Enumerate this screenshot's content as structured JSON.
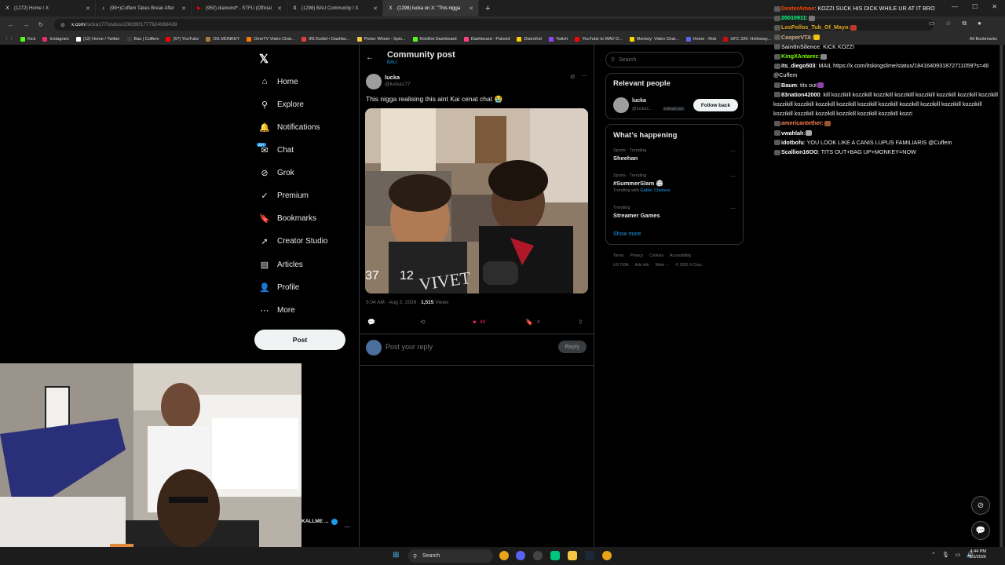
{
  "browser": {
    "tabs": [
      {
        "label": "(1272) Home / X",
        "fav": "X",
        "color": "#000000"
      },
      {
        "label": "(99+)Cuffem Takes Break After",
        "fav": "♪",
        "color": "#000000"
      },
      {
        "label": "(950) diamond* - STFU (Official",
        "fav": "▶",
        "color": "#ff0000"
      },
      {
        "label": "(1298) BAU Community / X",
        "fav": "X",
        "color": "#000000"
      },
      {
        "label": "(1298) lucka on X: \"This nigga",
        "fav": "X",
        "color": "#000000",
        "active": true
      }
    ],
    "new_tab": "+",
    "url_host": "x.com",
    "url_path": "/lucka177/status/2083901777624068439",
    "window_controls": [
      "—",
      "☐",
      "✕"
    ],
    "bookmarks": [
      {
        "label": "Kick",
        "color": "#53fc18"
      },
      {
        "label": "Instagram",
        "color": "#e1306c"
      },
      {
        "label": "(12) Home / Twitter",
        "color": "#ffffff"
      },
      {
        "label": "Bau | Cuffem",
        "color": "#3d3d3d"
      },
      {
        "label": "(57) YouTube",
        "color": "#ff0000"
      },
      {
        "label": "OG MONKEY",
        "color": "#a87a3d"
      },
      {
        "label": "OmeTV Video Chat...",
        "color": "#ff7a00"
      },
      {
        "label": "IRLToolkit • Dashbo...",
        "color": "#e63b3b"
      },
      {
        "label": "Picker Wheel - Spin...",
        "color": "#f5c542"
      },
      {
        "label": "KickBot Dashboard",
        "color": "#53fc18"
      },
      {
        "label": "Dashboard - Pulsoid",
        "color": "#ff4081"
      },
      {
        "label": "DistroKid",
        "color": "#ffcc00"
      },
      {
        "label": "Twitch",
        "color": "#9146ff"
      },
      {
        "label": "YouTube to WAV D...",
        "color": "#ff0000"
      },
      {
        "label": "Monkey: Video Chat...",
        "color": "#ffd700"
      },
      {
        "label": "Home - Rob",
        "color": "#5865f2"
      },
      {
        "label": "UFC 326: Holloway...",
        "color": "#d20a0a"
      }
    ],
    "all_bookmarks": "All Bookmarks"
  },
  "x_nav": {
    "logo": "𝕏",
    "items": [
      {
        "label": "Home",
        "icon": "⌂"
      },
      {
        "label": "Explore",
        "icon": "⚲"
      },
      {
        "label": "Notifications",
        "icon": "🔔"
      },
      {
        "label": "Chat",
        "icon": "✉"
      },
      {
        "label": "Grok",
        "icon": "⊘"
      },
      {
        "label": "Premium",
        "icon": "✓"
      },
      {
        "label": "Bookmarks",
        "icon": "🔖"
      },
      {
        "label": "Creator Studio",
        "icon": "➚"
      },
      {
        "label": "Articles",
        "icon": "▤"
      },
      {
        "label": "Profile",
        "icon": "👤"
      },
      {
        "label": "More",
        "icon": "⋯"
      }
    ],
    "chat_badge": "20+",
    "post_button": "Post"
  },
  "post": {
    "header_title": "Community post",
    "header_sub": "BAU",
    "author_name": "lucka",
    "author_handle": "@lucka177",
    "text": "This nigga realising this aint Kai cenat chat 😭",
    "overlay_numbers": [
      "37",
      "12"
    ],
    "shirt_text": "VIVET",
    "meta_time": "5:04 AM · Aug 2, 2026 · ",
    "views_count": "1,515",
    "views_label": " Views",
    "likes": "44",
    "bookmarks": "4",
    "reply_placeholder": "Post your reply",
    "reply_button": "Reply",
    "profile_row_name": "KALLME ..."
  },
  "sidebar": {
    "search_placeholder": "Search",
    "relevant_title": "Relevant people",
    "rp_name": "lucka",
    "rp_handle": "@lucka1...",
    "rp_follows_you": "Follows you",
    "follow_back": "Follow back",
    "happening_title": "What’s happening",
    "trends": [
      {
        "context": "Sports · Trending",
        "title": "Sheehan",
        "sub": ""
      },
      {
        "context": "Sports · Trending",
        "title": "#SummerSlam 🏟",
        "sub_prefix": "Trending with ",
        "sub": "Gable, Chelsea"
      },
      {
        "context": "Trending",
        "title": "Streamer Games",
        "sub": ""
      }
    ],
    "show_more": "Show more",
    "footer_line1": [
      "Terms",
      "Privacy",
      "Cookies",
      "Accessibility"
    ],
    "footer_line2": [
      "US TIDA",
      "Ads info",
      "More ···",
      "© 2026 X Corp."
    ]
  },
  "chat": [
    {
      "user": "DexterAmoe",
      "color": "#ff4500",
      "msg": ": KOZZI SUCK HIS DICK WHILE UR AT IT BRO",
      "emote": ""
    },
    {
      "user": "20010911",
      "color": "#00ff7f",
      "msg": ":",
      "emote": "#777777"
    },
    {
      "user": "LosPollos_Tub_Of_Mayo",
      "color": "#daa520",
      "msg": ":",
      "emote": "#c0392b"
    },
    {
      "user": "CasperVTA",
      "color": "#d2b48c",
      "msg": ":",
      "emote": "#f1c40f"
    },
    {
      "user": "SaintInSilence",
      "color": "#cccccc",
      "msg": ": KICK KOZZI",
      "emote": ""
    },
    {
      "user": "KingXAntarez",
      "color": "#7fff00",
      "msg": ":",
      "emote": "#888888"
    },
    {
      "user": "its_diego503",
      "color": "#ffffff",
      "msg": ": MAIL https://x.com/itskingslime/status/1841640931872711059?s=46 @Cuffem",
      "emote": ""
    },
    {
      "user": "Baum",
      "color": "#ffffff",
      "msg": ": tits out",
      "emote": "#8e44ad"
    },
    {
      "user": "83nation42000",
      "color": "#ffffff",
      "msg": ": kill kozzikill kozzikill kozzikill kozzikill kozzikill kozzikill kozzikill kozzikill kozzikill kozzikill kozzikill kozzikill kozzikill kozzikill kozzikill kozzikill kozzikill kozzikill kozzikill kozzikill kozzikill kozzikill kozzikill kozzikill kozzi",
      "emote": ""
    },
    {
      "user": "americantether",
      "color": "#ff7f50",
      "msg": ":",
      "emote": "#a0522d"
    },
    {
      "user": "vwahlah",
      "color": "#ffffff",
      "msg": ":",
      "emote": "#aaaaaa"
    },
    {
      "user": "idotbofu",
      "color": "#ffffff",
      "msg": ": YOU LOOK LIKE A CANIS LUPUS FAMILIARIS @Cuffem",
      "emote": ""
    },
    {
      "user": "Scallion16OO",
      "color": "#ffffff",
      "msg": ": TITS OUT+BAG UP+MONKEY=NOW",
      "emote": ""
    }
  ],
  "taskbar": {
    "search": "Search",
    "time": "4:44 PM",
    "date": "8/2/2026"
  }
}
